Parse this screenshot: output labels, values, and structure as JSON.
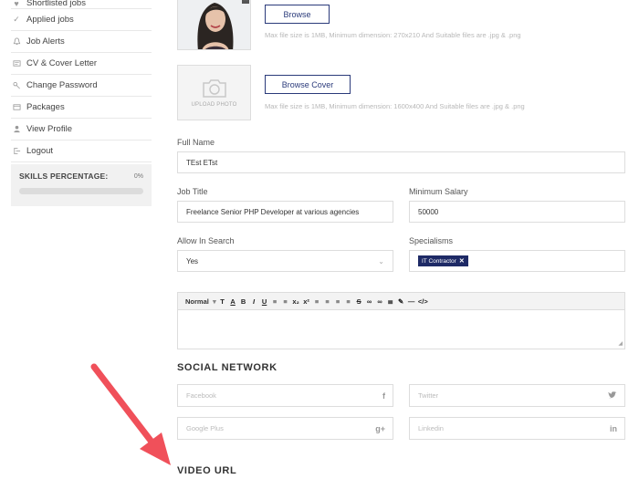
{
  "sidebar": {
    "items": [
      {
        "label": "Shortlisted jobs",
        "icon": "heart-icon"
      },
      {
        "label": "Applied jobs",
        "icon": "check-icon"
      },
      {
        "label": "Job Alerts",
        "icon": "bell-icon"
      },
      {
        "label": "CV & Cover Letter",
        "icon": "document-icon"
      },
      {
        "label": "Change Password",
        "icon": "key-icon"
      },
      {
        "label": "Packages",
        "icon": "package-icon"
      },
      {
        "label": "View Profile",
        "icon": "user-icon"
      },
      {
        "label": "Logout",
        "icon": "logout-icon"
      }
    ],
    "skills": {
      "label": "SKILLS PERCENTAGE:",
      "percent_text": "0%",
      "percent": 0
    }
  },
  "profile": {
    "browse_label": "Browse",
    "avatar_hint": "Max file size is 1MB, Minimum dimension: 270x210 And Suitable files are .jpg & .png",
    "upload_photo_text": "UPLOAD PHOTO",
    "browse_cover_label": "Browse Cover",
    "cover_hint": "Max file size is 1MB, Minimum dimension: 1600x400 And Suitable files are .jpg & .png"
  },
  "form": {
    "full_name": {
      "label": "Full Name",
      "value": "TEst ETst"
    },
    "job_title": {
      "label": "Job Title",
      "value": "Freelance Senior PHP Developer at various agencies"
    },
    "min_salary": {
      "label": "Minimum Salary",
      "value": "50000"
    },
    "allow_search": {
      "label": "Allow In Search",
      "value": "Yes"
    },
    "specialisms": {
      "label": "Specialisms",
      "tag": "IT Contractor"
    }
  },
  "editor": {
    "format_label": "Normal",
    "tools": [
      "T",
      "A",
      "B",
      "I",
      "U",
      "≡",
      "≡",
      "x₂",
      "x²",
      "≡",
      "≡",
      "≡",
      "≡",
      "S",
      "∞",
      "∞",
      "≣",
      "✎",
      "—",
      "</>"
    ]
  },
  "social": {
    "title": "SOCIAL NETWORK",
    "facebook": {
      "placeholder": "Facebook",
      "icon_char": "f"
    },
    "twitter": {
      "placeholder": "Twitter",
      "icon_char": "t"
    },
    "google": {
      "placeholder": "Google Plus",
      "icon_char": "g+"
    },
    "linkedin": {
      "placeholder": "Linkedin",
      "icon_char": "in"
    }
  },
  "video": {
    "title": "VIDEO URL"
  },
  "colors": {
    "accent": "#2a3a7a",
    "arrow": "#f0505a"
  }
}
